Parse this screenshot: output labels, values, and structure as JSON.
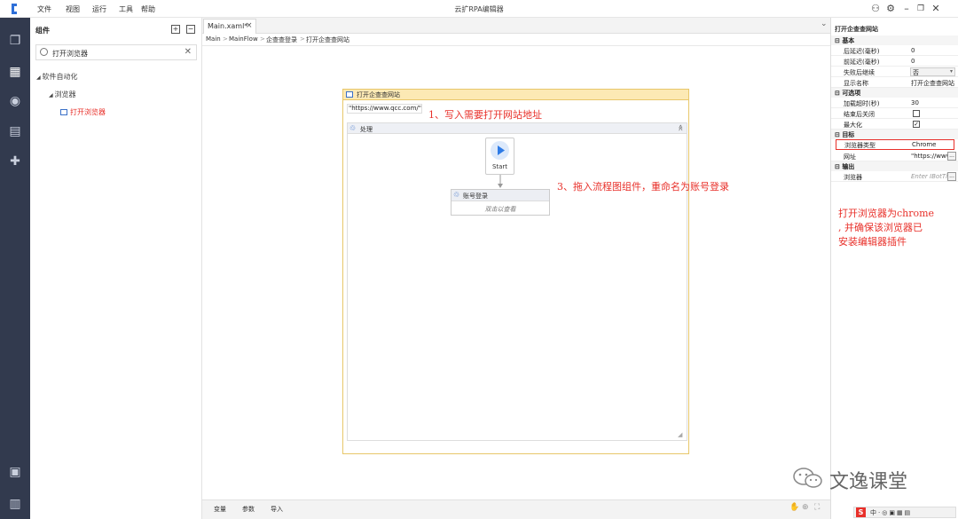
{
  "app": {
    "title": "云扩RPA编辑器"
  },
  "menu": [
    "文件",
    "视图",
    "运行",
    "工具",
    "帮助"
  ],
  "panel": {
    "title": "组件",
    "search_value": "打开浏览器",
    "tree": {
      "root": "软件自动化",
      "child": "浏览器",
      "leaf": "打开浏览器"
    }
  },
  "tab": {
    "label": "Main.xaml*",
    "close": "×"
  },
  "tabstrip": {
    "chevron": "⌄"
  },
  "breadcrumb": [
    "Main",
    "MainFlow",
    "企查查登录",
    "打开企查查网站"
  ],
  "breadcrumb_sep": ">",
  "sequence": {
    "title": "打开企查查网站",
    "url_value": "\"https://www.qcc.com/\"",
    "flow_title": "处理",
    "collapse": "≫",
    "start_label": "Start",
    "activity_title": "账号登录",
    "activity_hint": "双击以查看"
  },
  "annotations": {
    "step1": "1、写入需要打开网站地址",
    "step3": "3、拖入流程图组件，重命名为账号登录",
    "note": [
      "打开浏览器为chrome",
      ", 并确保该浏览器已",
      "安装编辑器插件"
    ]
  },
  "bottom_tabs": [
    "变量",
    "参数",
    "导入"
  ],
  "props": {
    "title": "打开企查查网站",
    "sections": {
      "basic": "基本",
      "options": "可选项",
      "target": "目标",
      "output": "输出"
    },
    "rows": {
      "delay_after": {
        "label": "后延迟(毫秒)",
        "value": "0"
      },
      "delay_before": {
        "label": "前延迟(毫秒)",
        "value": "0"
      },
      "continue_on_error": {
        "label": "失败后继续",
        "value": "否"
      },
      "display_name": {
        "label": "显示名称",
        "value": "打开企查查网站"
      },
      "load_timeout": {
        "label": "加载超时(秒)",
        "value": "30"
      },
      "close_on_end": {
        "label": "结束后关闭"
      },
      "maximize": {
        "label": "最大化",
        "check": "✓"
      },
      "browser_type": {
        "label": "浏览器类型",
        "value": "Chrome"
      },
      "url": {
        "label": "网址",
        "value": "\"https://www",
        "btn": "..."
      },
      "browser_out": {
        "label": "浏览器",
        "value": "Enter IBotTi",
        "btn": "..."
      }
    }
  },
  "watermark": "文逸课堂",
  "colors": {
    "annotation_red": "#e8302a",
    "nav_bg": "#323a4e",
    "sequence_border": "#e8c76a",
    "start_blue": "#2e7be6"
  }
}
